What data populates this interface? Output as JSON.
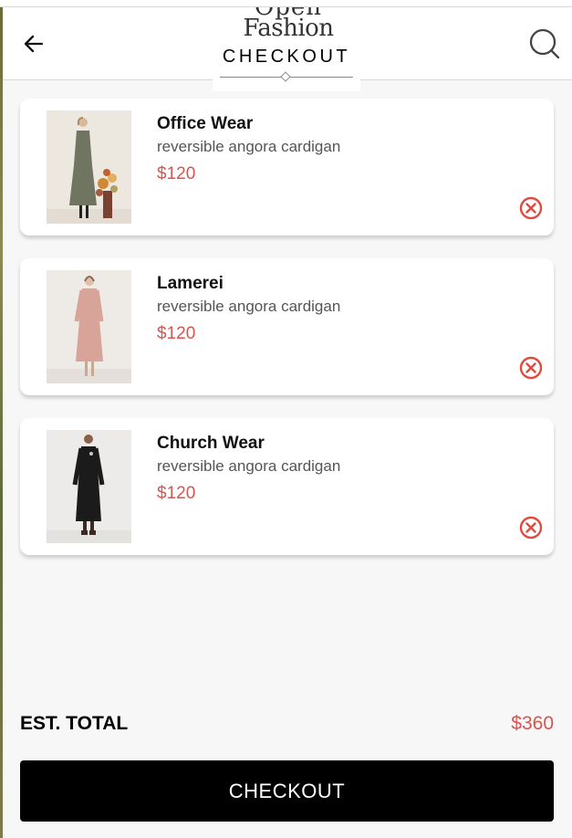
{
  "header": {
    "logo_line1": "Open",
    "logo_line2": "Fashion",
    "title": "CHECKOUT",
    "back_icon": "arrow-left-icon",
    "search_icon": "search-icon"
  },
  "cart": {
    "items": [
      {
        "name": "Office Wear",
        "description": "reversible angora cardigan",
        "price": "$120",
        "dress_color": "#6f7560",
        "bg": "#ece7df"
      },
      {
        "name": "Lamerei",
        "description": "reversible angora cardigan",
        "price": "$120",
        "dress_color": "#d8a49a",
        "bg": "#eeeae6"
      },
      {
        "name": "Church Wear",
        "description": "reversible angora cardigan",
        "price": "$120",
        "dress_color": "#1b1b1b",
        "bg": "#ecebe9"
      }
    ],
    "remove_icon": "remove-circle-icon"
  },
  "summary": {
    "total_label": "EST. TOTAL",
    "total_value": "$360"
  },
  "actions": {
    "checkout_label": "CHECKOUT"
  },
  "colors": {
    "accent": "#d9534f",
    "button_bg": "#000000",
    "page_bg": "#f7f7f7"
  }
}
